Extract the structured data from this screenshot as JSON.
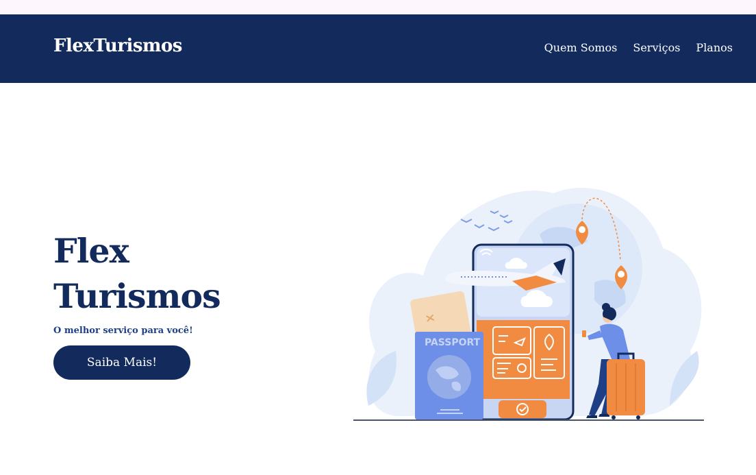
{
  "navbar": {
    "brand": "FlexTurismos",
    "links": [
      {
        "label": "Quem Somos"
      },
      {
        "label": "Serviços"
      },
      {
        "label": "Planos"
      }
    ],
    "background": "#132b5c"
  },
  "hero": {
    "title_line1": "Flex",
    "title_line2": "Turismos",
    "subtitle": "O melhor serviço para você!",
    "cta_label": "Saiba Mais!",
    "illustration": {
      "passport_text": "PASSPORT",
      "accent": "#f28b42",
      "blue": "#6e8fe8"
    }
  },
  "colors": {
    "primary": "#132b5c",
    "accent": "#f28b42",
    "background": "#ffffff"
  }
}
